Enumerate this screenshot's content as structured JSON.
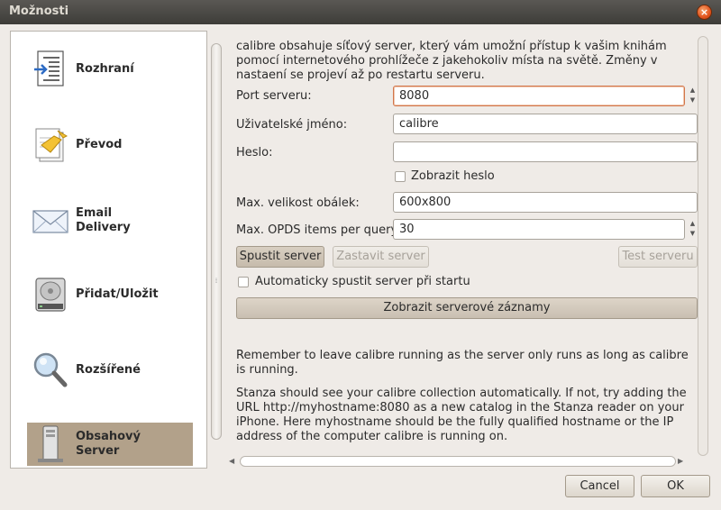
{
  "window": {
    "title": "Možnosti",
    "close": "×"
  },
  "sidebar": {
    "items": [
      {
        "label": "Rozhraní",
        "icon": "interface-icon"
      },
      {
        "label": "Převod",
        "icon": "convert-icon"
      },
      {
        "label": "Email Delivery",
        "icon": "email-icon"
      },
      {
        "label": "Přidat/Uložit",
        "icon": "add-save-icon"
      },
      {
        "label": "Rozšířené",
        "icon": "advanced-icon"
      },
      {
        "label": "Obsahový Server",
        "icon": "server-icon",
        "selected": true
      }
    ]
  },
  "content": {
    "description": "calibre obsahuje síťový server, který vám umožní přístup k vašim knihám pomocí internetového prohlížeče z jakehokoliv místa na světě. Změny v nastaení se projeví až po restartu serveru.",
    "port": {
      "label": "Port serveru:",
      "value": "8080"
    },
    "username": {
      "label": "Uživatelské jméno:",
      "value": "calibre"
    },
    "password": {
      "label": "Heslo:",
      "value": ""
    },
    "show_password": {
      "label": "Zobrazit heslo",
      "checked": false
    },
    "max_cover": {
      "label": "Max. velikost obálek:",
      "value": "600x800"
    },
    "max_opds": {
      "label": "Max. OPDS items per query:",
      "value": "30"
    },
    "buttons": {
      "start": "Spustit server",
      "stop": "Zastavit server",
      "test": "Test serveru"
    },
    "autostart": {
      "label": "Automaticky spustit server při startu",
      "checked": false
    },
    "show_logs": "Zobrazit serverové záznamy",
    "note1": "Remember to leave calibre running as the server only runs as long as calibre is running.",
    "note2": "Stanza should see your calibre collection automatically. If not, try adding the URL http://myhostname:8080 as a new catalog in the Stanza reader on your iPhone. Here myhostname should be the fully qualified hostname or the IP address of the computer calibre is running on."
  },
  "footer": {
    "cancel": "Cancel",
    "ok": "OK"
  }
}
